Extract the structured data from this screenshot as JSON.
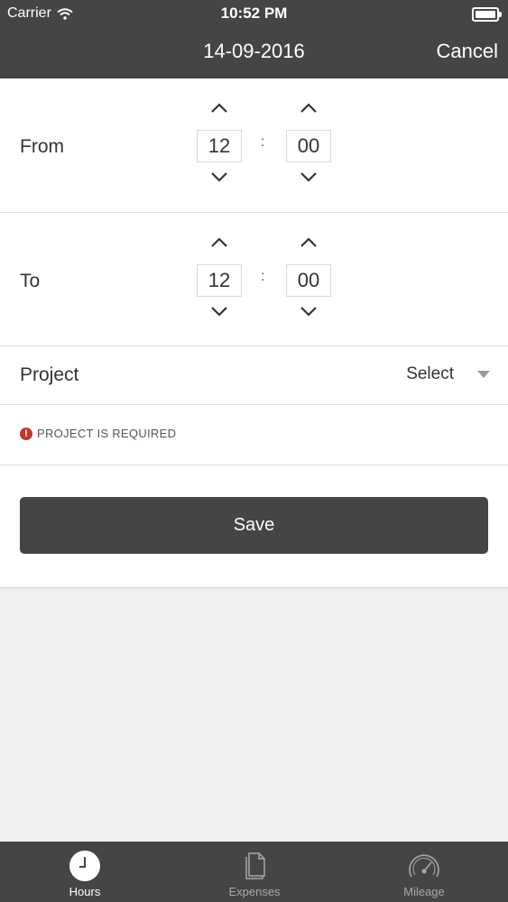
{
  "status": {
    "carrier": "Carrier",
    "time": "10:52 PM"
  },
  "nav": {
    "title": "14-09-2016",
    "cancel": "Cancel"
  },
  "from": {
    "label": "From",
    "hours": "12",
    "minutes": "00",
    "separator": ":"
  },
  "to": {
    "label": "To",
    "hours": "12",
    "minutes": "00",
    "separator": ":"
  },
  "project": {
    "label": "Project",
    "select_text": "Select"
  },
  "error": {
    "icon": "!",
    "text": "PROJECT IS REQUIRED"
  },
  "save": {
    "label": "Save"
  },
  "tabs": [
    {
      "label": "Hours",
      "icon": "clock-icon",
      "active": true
    },
    {
      "label": "Expenses",
      "icon": "document-icon",
      "active": false
    },
    {
      "label": "Mileage",
      "icon": "speedometer-icon",
      "active": false
    }
  ],
  "colors": {
    "bar": "#464446",
    "error": "#c0392b",
    "background": "#efeff1"
  }
}
